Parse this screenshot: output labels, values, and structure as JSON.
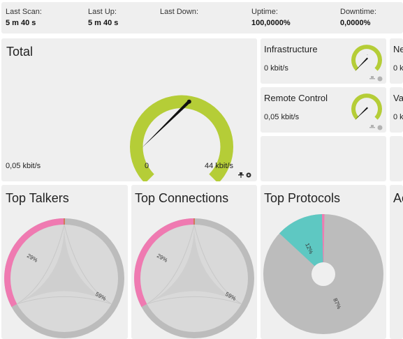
{
  "status": {
    "last_scan": {
      "label": "Last Scan:",
      "value": "5 m 40 s"
    },
    "last_up": {
      "label": "Last Up:",
      "value": "5 m 40 s"
    },
    "last_down": {
      "label": "Last Down:",
      "value": ""
    },
    "uptime": {
      "label": "Uptime:",
      "value": "100,0000%"
    },
    "downtime": {
      "label": "Downtime:",
      "value": "0,0000%"
    }
  },
  "total": {
    "title": "Total",
    "current_value": "0,05 kbit/s",
    "gauge_min": "0",
    "gauge_max": "44 kbit/s"
  },
  "mini_channels": [
    {
      "title": "Infrastructure",
      "value": "0 kbit/s"
    },
    {
      "title": "Ne",
      "value": "0 k"
    },
    {
      "title": "Remote Control",
      "value": "0,05 kbit/s"
    },
    {
      "title": "Va",
      "value": "0 k"
    }
  ],
  "top_talkers": {
    "title": "Top Talkers",
    "pct_a": "29%",
    "pct_b": "59%"
  },
  "top_connections": {
    "title": "Top Connections",
    "pct_a": "29%",
    "pct_b": "59%"
  },
  "top_protocols": {
    "title": "Top Protocols",
    "pct_a": "12%",
    "pct_b": "87%"
  },
  "fourth_panel": {
    "title": "Ac"
  },
  "colors": {
    "gauge": "#b5cd37",
    "needle": "#111111",
    "pink": "#ef7ab1",
    "teal": "#5ec8c2",
    "gray": "#bcbcbc",
    "light_gray": "#d9d9d9",
    "panel_bg": "#efefef"
  },
  "icons": [
    "pin-icon",
    "gear-icon",
    "export-icon",
    "table-icon"
  ]
}
